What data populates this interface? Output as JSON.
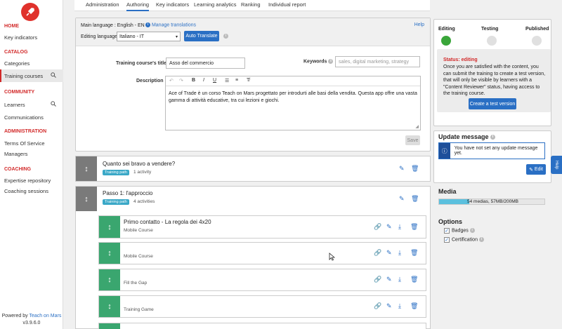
{
  "sidebar": {
    "sections": [
      {
        "title": "HOME",
        "items": [
          {
            "label": "Key indicators"
          }
        ]
      },
      {
        "title": "CATALOG",
        "items": [
          {
            "label": "Categories"
          },
          {
            "label": "Training courses"
          }
        ]
      },
      {
        "title": "COMMUNITY",
        "items": [
          {
            "label": "Learners"
          },
          {
            "label": "Communications"
          }
        ]
      },
      {
        "title": "ADMINISTRATION",
        "items": [
          {
            "label": "Terms Of Service"
          },
          {
            "label": "Managers"
          }
        ]
      },
      {
        "title": "COACHING",
        "items": [
          {
            "label": "Expertise repository"
          },
          {
            "label": "Coaching sessions"
          }
        ]
      }
    ],
    "powered_by": "Powered by",
    "brand": "Teach on Mars",
    "version": "v3.9.6.0"
  },
  "tabs": [
    "Administration",
    "Authoring",
    "Key indicators",
    "Learning analytics",
    "Ranking",
    "Individual report"
  ],
  "lang": {
    "main_language": "Main language : English - EN",
    "manage_translations": "Manage translations",
    "help": "Help",
    "editing_language_label": "Editing language:",
    "editing_language_value": "Italiano - IT",
    "auto_translate": "Auto Translate"
  },
  "form": {
    "title_label": "Training course's title",
    "title_value": "Asso del commercio",
    "keywords_label": "Keywords",
    "keywords_placeholder": "sales, digital marketing, strategy",
    "description_label": "Description",
    "description_text": "Ace of Trade è un corso Teach on Mars progettato per introdurti alle basi della vendita. Questa app offre una vasta gamma di attività educative, tra cui lezioni e giochi.",
    "save": "Save"
  },
  "paths": [
    {
      "title": "Quanto sei bravo a vendere?",
      "badge": "Training path",
      "count": "1 activity"
    },
    {
      "title": "Passo 1: l'approccio",
      "badge": "Training path",
      "count": "4 activities"
    }
  ],
  "activities": [
    {
      "title": "Primo contatto - La regola dei 4x20",
      "type": "Mobile Course"
    },
    {
      "title": "",
      "type": "Mobile Course"
    },
    {
      "title": "",
      "type": "Fill the Gap"
    },
    {
      "title": "",
      "type": "Training Game"
    }
  ],
  "status": {
    "steps": [
      "Editing",
      "Testing",
      "Published"
    ],
    "active_step": 0,
    "heading": "Status: editing",
    "text": "Once you are satisfied with the content, you can submit the training to create a test version, that will only be visible by learners with a \"Content Reviewer\" status, having access to the training course.",
    "button": "Create a test version",
    "colors": {
      "active": "#3aa63a",
      "inactive": "#e0e0e0"
    }
  },
  "update_message": {
    "title": "Update message",
    "alert": "You have not set any update message yet.",
    "edit": "Edit"
  },
  "media": {
    "title": "Media",
    "text": "54 medias, 57MB/200MB",
    "fill_fraction": 0.285
  },
  "options": {
    "title": "Options",
    "items": [
      {
        "label": "Badges",
        "checked": true
      },
      {
        "label": "Certification",
        "checked": true
      }
    ]
  },
  "help_tab": "Help",
  "colors": {
    "accent": "#2a6fc4",
    "brand": "#d22a2a",
    "activity_handle": "#3aa66f",
    "path_handle": "#7a7a7a"
  }
}
